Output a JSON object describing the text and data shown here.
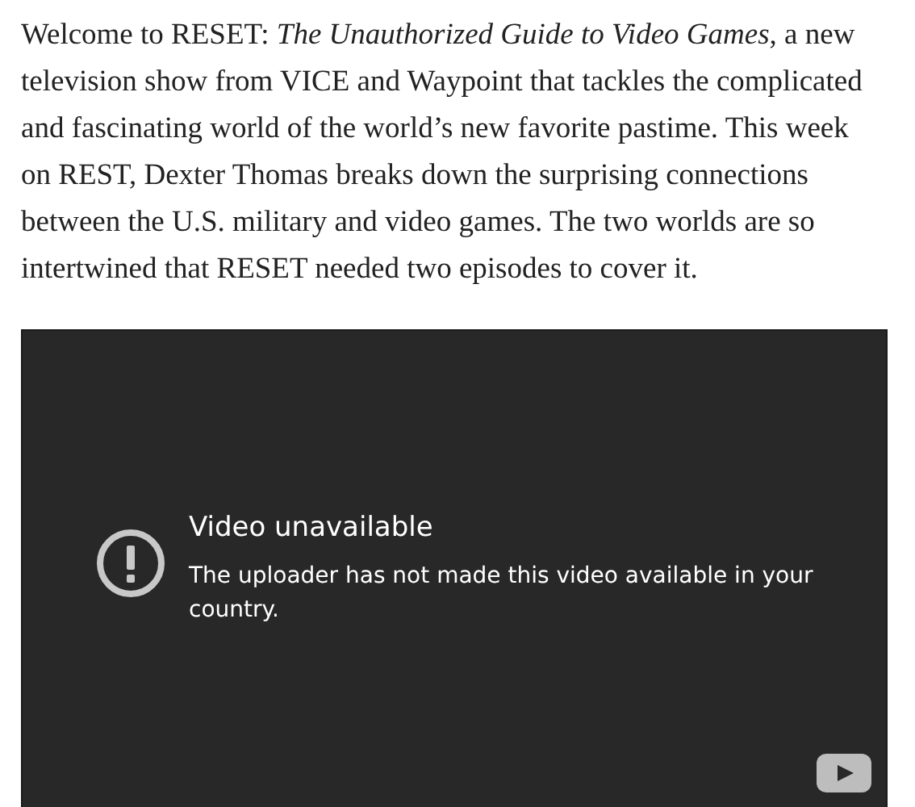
{
  "article": {
    "paragraph": "Welcome to RESET: *The Unauthorized Guide to Video Games*, a new television show from VICE and Waypoint that tackles the complicated and fascinating world of the world’s new favorite pastime. This week on REST, Dexter Thomas breaks down the surprising connections between the U.S. military and video games. The two worlds are so intertwined that RESET needed two episodes to cover it."
  },
  "video_embed": {
    "title": "Video unavailable",
    "message": "The uploader has not made this video available in your country."
  }
}
